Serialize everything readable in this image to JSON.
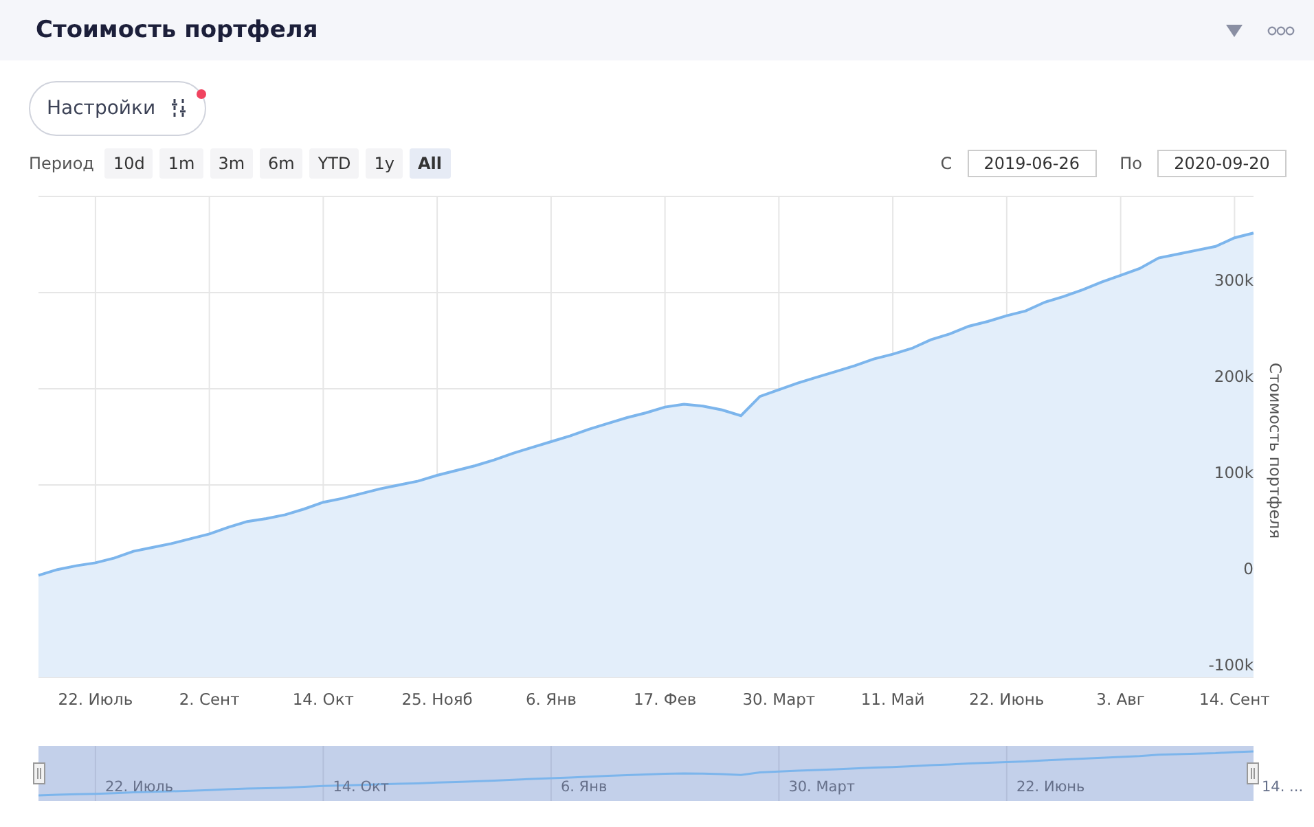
{
  "header": {
    "title": "Стоимость портфеля"
  },
  "settings": {
    "label": "Настройки",
    "notification": true
  },
  "period": {
    "label": "Период",
    "options": [
      {
        "label": "10d",
        "selected": false
      },
      {
        "label": "1m",
        "selected": false
      },
      {
        "label": "3m",
        "selected": false
      },
      {
        "label": "6m",
        "selected": false
      },
      {
        "label": "YTD",
        "selected": false
      },
      {
        "label": "1y",
        "selected": false
      },
      {
        "label": "All",
        "selected": true
      }
    ]
  },
  "range": {
    "from_label": "С",
    "from": "2019-06-26",
    "to_label": "По",
    "to": "2020-09-20"
  },
  "chart": {
    "chart_data": {
      "type": "area",
      "ylabel": "Стоимость портфеля",
      "categories": [
        null,
        null,
        null,
        "22. Июль",
        null,
        null,
        null,
        null,
        null,
        "2. Сент",
        null,
        null,
        null,
        null,
        null,
        "14. Окт",
        null,
        null,
        null,
        null,
        null,
        "25. Нояб",
        null,
        null,
        null,
        null,
        null,
        "6. Янв",
        null,
        null,
        null,
        null,
        null,
        "17. Фев",
        null,
        null,
        null,
        null,
        null,
        "30. Март",
        null,
        null,
        null,
        null,
        null,
        "11. Май",
        null,
        null,
        null,
        null,
        null,
        "22. Июнь",
        null,
        null,
        null,
        null,
        null,
        "3. Авг",
        null,
        null,
        null,
        null,
        null,
        "14. Сент",
        null
      ],
      "series": [
        {
          "color": "#7cb5ec",
          "values": [
            6000,
            12000,
            16000,
            19000,
            24000,
            31000,
            35000,
            39000,
            44000,
            49000,
            56000,
            62000,
            65000,
            69000,
            75000,
            82000,
            86000,
            91000,
            96000,
            100000,
            104000,
            110000,
            115000,
            120000,
            126000,
            133000,
            139000,
            145000,
            151000,
            158000,
            164000,
            170000,
            175000,
            181000,
            184000,
            182000,
            178000,
            172000,
            192000,
            199000,
            206000,
            212000,
            218000,
            224000,
            231000,
            236000,
            242000,
            251000,
            257000,
            265000,
            270000,
            276000,
            281000,
            290000,
            296000,
            303000,
            311000,
            318000,
            325000,
            336000,
            340000,
            344000,
            348000,
            357000,
            362000
          ]
        }
      ],
      "ylim": [
        -100000,
        400000
      ],
      "grid": true,
      "yticks": [
        {
          "value": -100000,
          "label": "-100k"
        },
        {
          "value": 0,
          "label": "0"
        },
        {
          "value": 100000,
          "label": "100k"
        },
        {
          "value": 200000,
          "label": "200k"
        },
        {
          "value": 300000,
          "label": "300k"
        }
      ]
    }
  },
  "navigator": {
    "labels": [
      "22. Июль",
      "14. Окт",
      "6. Янв",
      "30. Март",
      "22. Июнь",
      "14. ..."
    ]
  }
}
